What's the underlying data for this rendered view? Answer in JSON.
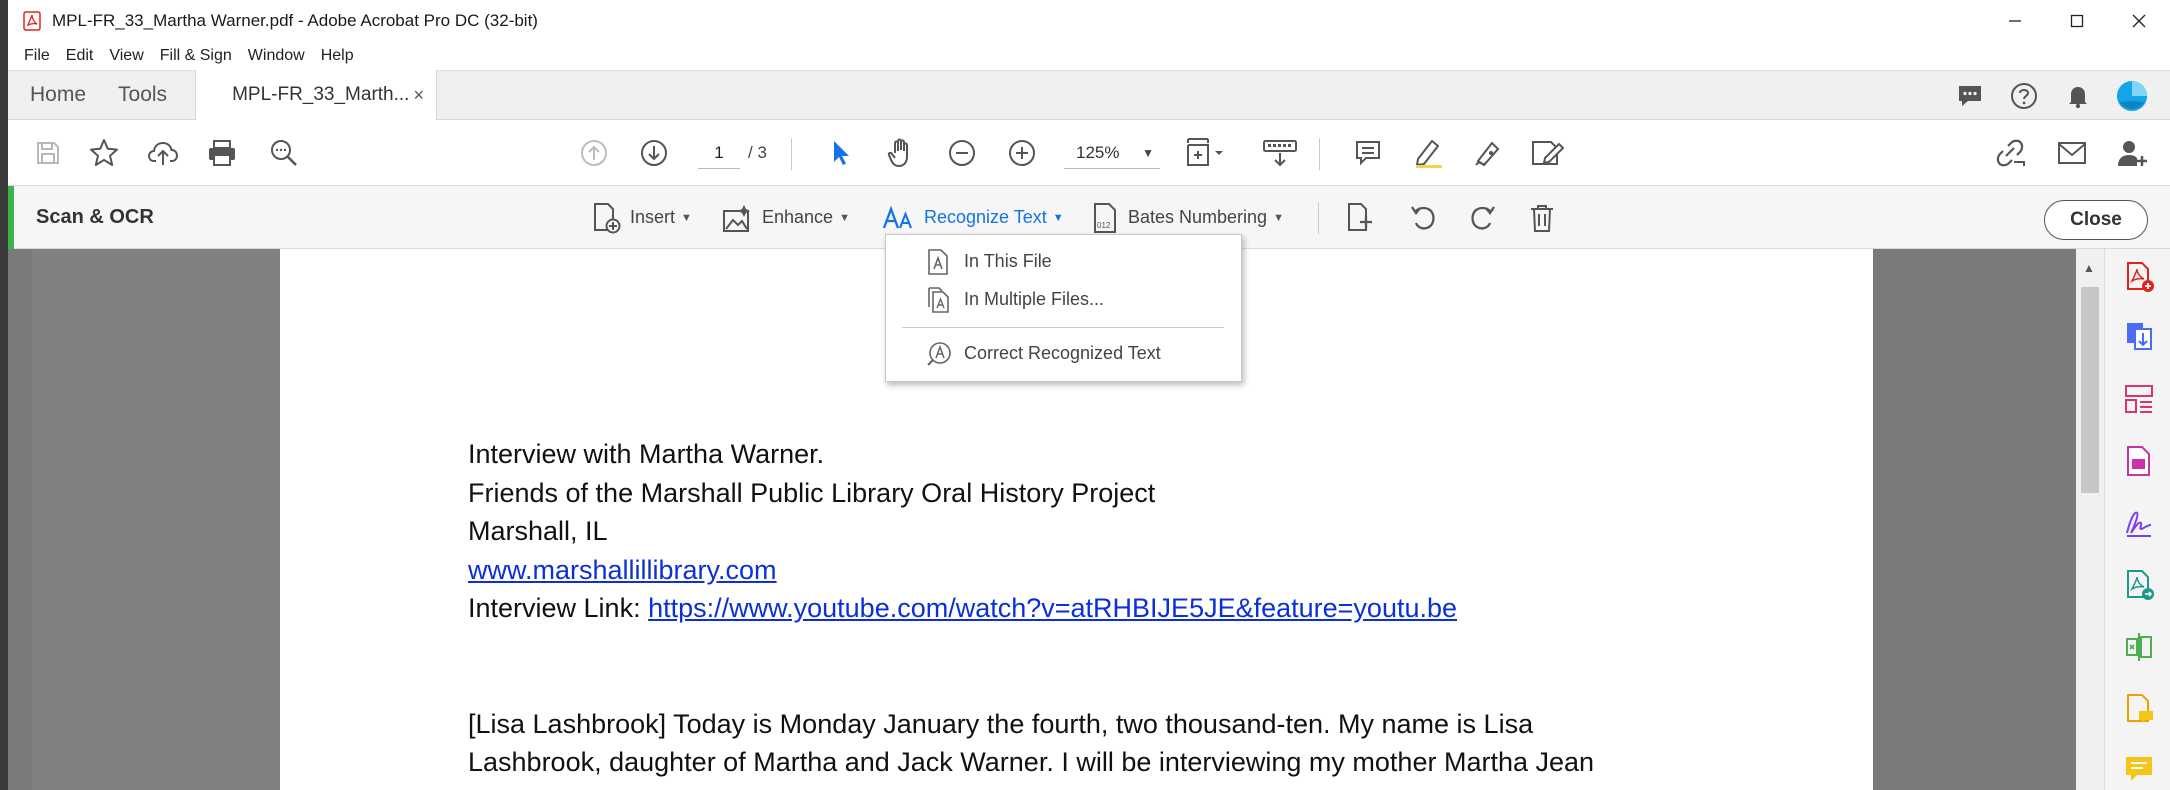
{
  "window": {
    "title": "MPL-FR_33_Martha Warner.pdf - Adobe Acrobat Pro DC (32-bit)",
    "controls": {
      "minimize": "—",
      "maximize": "☐",
      "close": "✕"
    }
  },
  "menu": {
    "items": [
      "File",
      "Edit",
      "View",
      "Fill & Sign",
      "Window",
      "Help"
    ]
  },
  "tabs": {
    "home": "Home",
    "tools": "Tools",
    "document": "MPL-FR_33_Marth...",
    "close": "×"
  },
  "toolbar": {
    "page_current": "1",
    "page_total": "/ 3",
    "zoom": "125%"
  },
  "scan_ocr": {
    "title": "Scan & OCR",
    "insert": "Insert",
    "enhance": "Enhance",
    "recognize_text": "Recognize Text",
    "bates_numbering": "Bates Numbering",
    "close": "Close"
  },
  "dropdown": {
    "in_this_file": "In This File",
    "in_multiple_files": "In Multiple Files...",
    "correct_recognized_text": "Correct Recognized Text"
  },
  "document": {
    "line1": "Interview with Martha Warner.",
    "line2": "Friends of the Marshall Public Library Oral History Project",
    "line3": "Marshall, IL",
    "link1": "www.marshallillibrary.com",
    "line5_label": "Interview Link: ",
    "link2": "https://www.youtube.com/watch?v=atRHBIJE5JE&feature=youtu.be",
    "para1_line1": "[Lisa Lashbrook] Today is Monday January the fourth, two thousand-ten. My name is Lisa",
    "para1_line2": "Lashbrook, daughter of Martha and Jack Warner. I will be interviewing my mother Martha Jean"
  },
  "colors": {
    "accent_blue": "#1473e6",
    "ocr_green": "#3cb34a",
    "pdf_red": "#e2231a"
  }
}
